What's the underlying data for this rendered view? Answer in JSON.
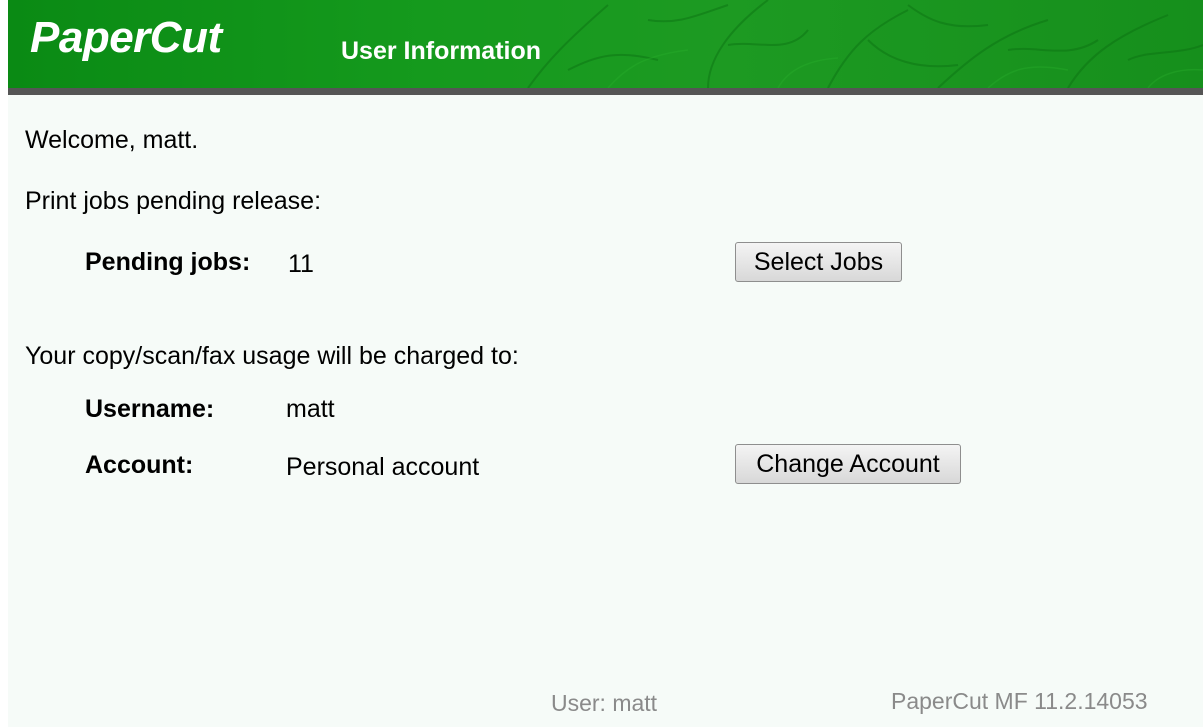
{
  "header": {
    "logo_text": "PaperCut",
    "title": "User Information",
    "colors": {
      "brand_green": "#1a951f",
      "divider": "#555555"
    }
  },
  "main": {
    "welcome": "Welcome, matt.",
    "print_section_label": "Print jobs pending release:",
    "pending_jobs_label": "Pending jobs:",
    "pending_jobs_value": "11",
    "select_jobs_button": "Select Jobs",
    "charge_section_label": "Your copy/scan/fax usage will be charged to:",
    "username_label": "Username:",
    "username_value": "matt",
    "account_label": "Account:",
    "account_value": "Personal account",
    "change_account_button": "Change Account"
  },
  "footer": {
    "user": "User: matt",
    "version": "PaperCut MF 11.2.14053"
  }
}
